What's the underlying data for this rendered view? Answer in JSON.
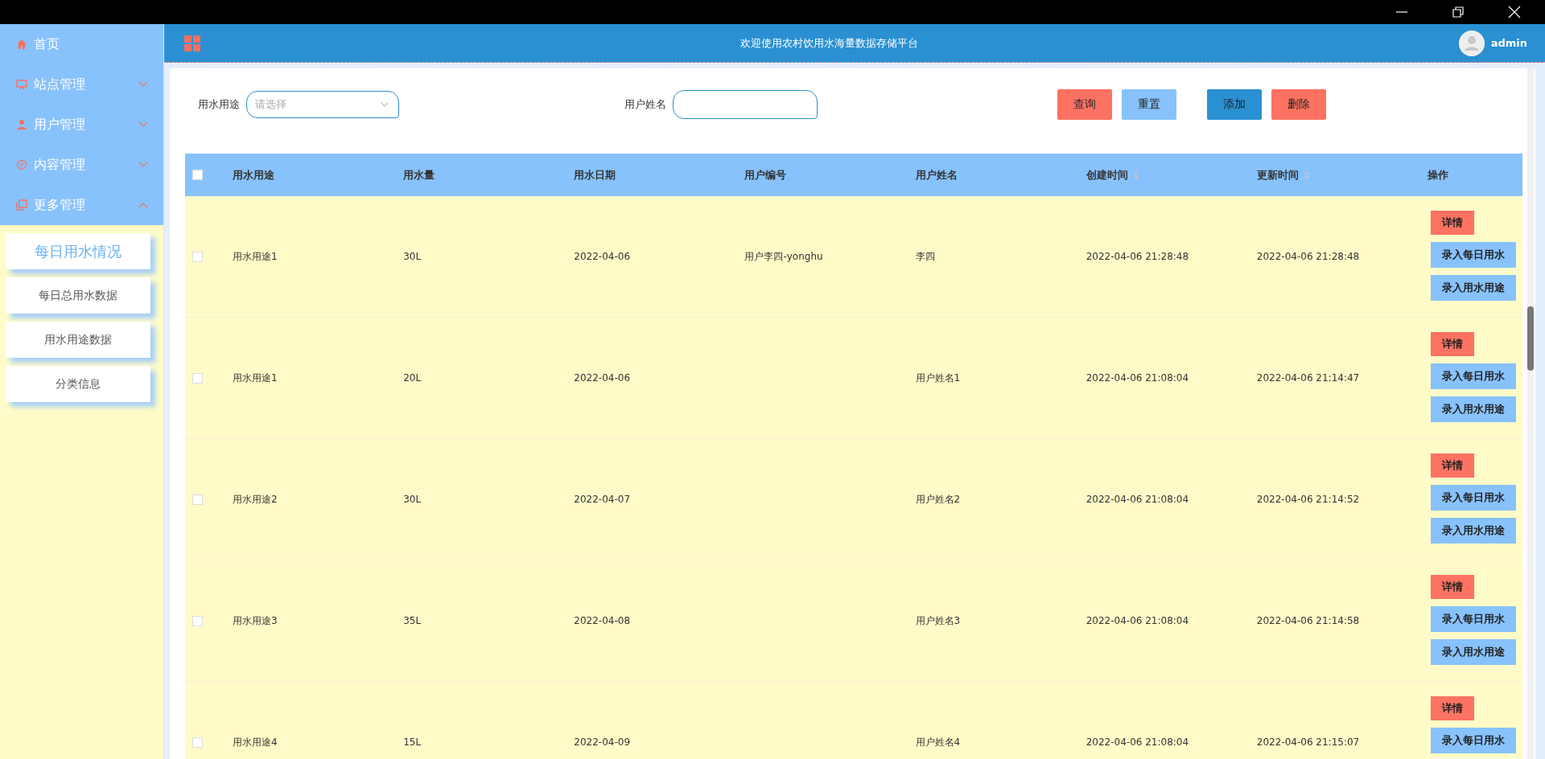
{
  "header": {
    "title": "欢迎使用农村饮用水海量数据存储平台",
    "user": "admin"
  },
  "sidebar": {
    "items": [
      {
        "label": "首页",
        "kind": "link"
      },
      {
        "label": "站点管理",
        "kind": "group",
        "expanded": false
      },
      {
        "label": "用户管理",
        "kind": "group",
        "expanded": false
      },
      {
        "label": "内容管理",
        "kind": "group",
        "expanded": false
      },
      {
        "label": "更多管理",
        "kind": "group",
        "expanded": true,
        "children": [
          {
            "label": "每日用水情况",
            "selected": true
          },
          {
            "label": "每日总用水数据",
            "selected": false
          },
          {
            "label": "用水用途数据",
            "selected": false
          },
          {
            "label": "分类信息",
            "selected": false
          }
        ]
      }
    ]
  },
  "search": {
    "fields": [
      {
        "label": "用水用途",
        "kind": "select",
        "placeholder": "请选择"
      },
      {
        "label": "用户姓名",
        "kind": "input"
      }
    ],
    "buttons": [
      {
        "label": "查询",
        "kind": "danger"
      },
      {
        "label": "重置",
        "kind": "light"
      },
      {
        "label": "添加",
        "kind": "primary"
      },
      {
        "label": "删除",
        "kind": "danger"
      }
    ]
  },
  "table": {
    "columns": [
      {
        "label": "用水用途",
        "sortable": false
      },
      {
        "label": "用水量",
        "sortable": false
      },
      {
        "label": "用水日期",
        "sortable": false
      },
      {
        "label": "用户编号",
        "sortable": false
      },
      {
        "label": "用户姓名",
        "sortable": false
      },
      {
        "label": "创建时间",
        "sortable": true
      },
      {
        "label": "更新时间",
        "sortable": true
      },
      {
        "label": "操作",
        "sortable": false
      }
    ],
    "header_checked": false,
    "rows": [
      {
        "checked": false,
        "cells": [
          "用水用途1",
          "30L",
          "2022-04-06",
          "用户李四-yonghu",
          "李四",
          "2022-04-06 21:28:48",
          "2022-04-06 21:28:48"
        ],
        "actions": [
          {
            "label": "详情",
            "kind": "danger"
          },
          {
            "label": "录入每日用水",
            "kind": "light"
          },
          {
            "label": "录入用水用途",
            "kind": "light"
          }
        ]
      },
      {
        "checked": false,
        "cells": [
          "用水用途1",
          "20L",
          "2022-04-06",
          "",
          "用户姓名1",
          "2022-04-06 21:08:04",
          "2022-04-06 21:14:47"
        ],
        "actions": [
          {
            "label": "详情",
            "kind": "danger"
          },
          {
            "label": "录入每日用水",
            "kind": "light"
          },
          {
            "label": "录入用水用途",
            "kind": "light"
          }
        ]
      },
      {
        "checked": false,
        "cells": [
          "用水用途2",
          "30L",
          "2022-04-07",
          "",
          "用户姓名2",
          "2022-04-06 21:08:04",
          "2022-04-06 21:14:52"
        ],
        "actions": [
          {
            "label": "详情",
            "kind": "danger"
          },
          {
            "label": "录入每日用水",
            "kind": "light"
          },
          {
            "label": "录入用水用途",
            "kind": "light"
          }
        ]
      },
      {
        "checked": false,
        "cells": [
          "用水用途3",
          "35L",
          "2022-04-08",
          "",
          "用户姓名3",
          "2022-04-06 21:08:04",
          "2022-04-06 21:14:58"
        ],
        "actions": [
          {
            "label": "详情",
            "kind": "danger"
          },
          {
            "label": "录入每日用水",
            "kind": "light"
          },
          {
            "label": "录入用水用途",
            "kind": "light"
          }
        ]
      },
      {
        "checked": false,
        "cells": [
          "用水用途4",
          "15L",
          "2022-04-09",
          "",
          "用户姓名4",
          "2022-04-06 21:08:04",
          "2022-04-06 21:15:07"
        ],
        "actions": [
          {
            "label": "详情",
            "kind": "danger"
          },
          {
            "label": "录入每日用水",
            "kind": "light"
          }
        ]
      }
    ]
  }
}
